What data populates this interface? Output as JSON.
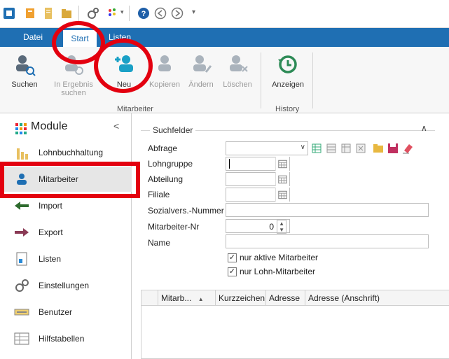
{
  "quick_access": {
    "icons": [
      "app-icon",
      "pin-icon",
      "document-icon",
      "folder-icon",
      "gears-icon",
      "color-palette-icon",
      "help-icon",
      "back-icon",
      "forward-icon",
      "dropdown-icon"
    ]
  },
  "tabs": [
    {
      "label": "Datei"
    },
    {
      "label": "Start",
      "active": true
    },
    {
      "label": "Listen"
    }
  ],
  "ribbon": {
    "groups": [
      {
        "label": "Mitarbeiter"
      },
      {
        "label": "History"
      }
    ],
    "buttons": {
      "search": "Suchen",
      "search_results": "In Ergebnis suchen",
      "new": "Neu",
      "copy": "Kopieren",
      "edit": "Ändern",
      "delete": "Löschen",
      "show": "Anzeigen"
    }
  },
  "sidebar": {
    "title": "Module",
    "collapse": "<",
    "items": [
      {
        "label": "Lohnbuchhaltung",
        "icon": "bar-chart-icon"
      },
      {
        "label": "Mitarbeiter",
        "icon": "person-icon",
        "selected": true
      },
      {
        "label": "Import",
        "icon": "arrow-left-icon"
      },
      {
        "label": "Export",
        "icon": "arrow-right-icon"
      },
      {
        "label": "Listen",
        "icon": "list-document-icon"
      },
      {
        "label": "Einstellungen",
        "icon": "gears-icon"
      },
      {
        "label": "Benutzer",
        "icon": "keyboard-icon"
      },
      {
        "label": "Hilfstabellen",
        "icon": "table-icon"
      }
    ]
  },
  "search_fields": {
    "title": "Suchfelder",
    "labels": {
      "abfrage": "Abfrage",
      "lohngruppe": "Lohngruppe",
      "abteilung": "Abteilung",
      "filiale": "Filiale",
      "sozialvers": "Sozialvers.-Nummer",
      "mitarbeiter_nr": "Mitarbeiter-Nr",
      "name": "Name"
    },
    "values": {
      "abfrage": "",
      "lohngruppe": "",
      "abteilung": "",
      "filiale": "",
      "sozialvers": "",
      "mitarbeiter_nr": "0",
      "name": ""
    },
    "checkboxes": [
      {
        "label": "nur aktive Mitarbeiter",
        "checked": true
      },
      {
        "label": "nur Lohn-Mitarbeiter",
        "checked": true
      }
    ]
  },
  "grid": {
    "columns": [
      "Mitarb...",
      "Kurzzeichen",
      "Adresse",
      "Adresse (Anschrift)"
    ],
    "sort_indicator": "▲"
  },
  "colors": {
    "accent_blue": "#1f6fb3",
    "highlight_red": "#e3000f",
    "new_teal": "#1aa0c6",
    "history_green": "#2e8b57"
  }
}
